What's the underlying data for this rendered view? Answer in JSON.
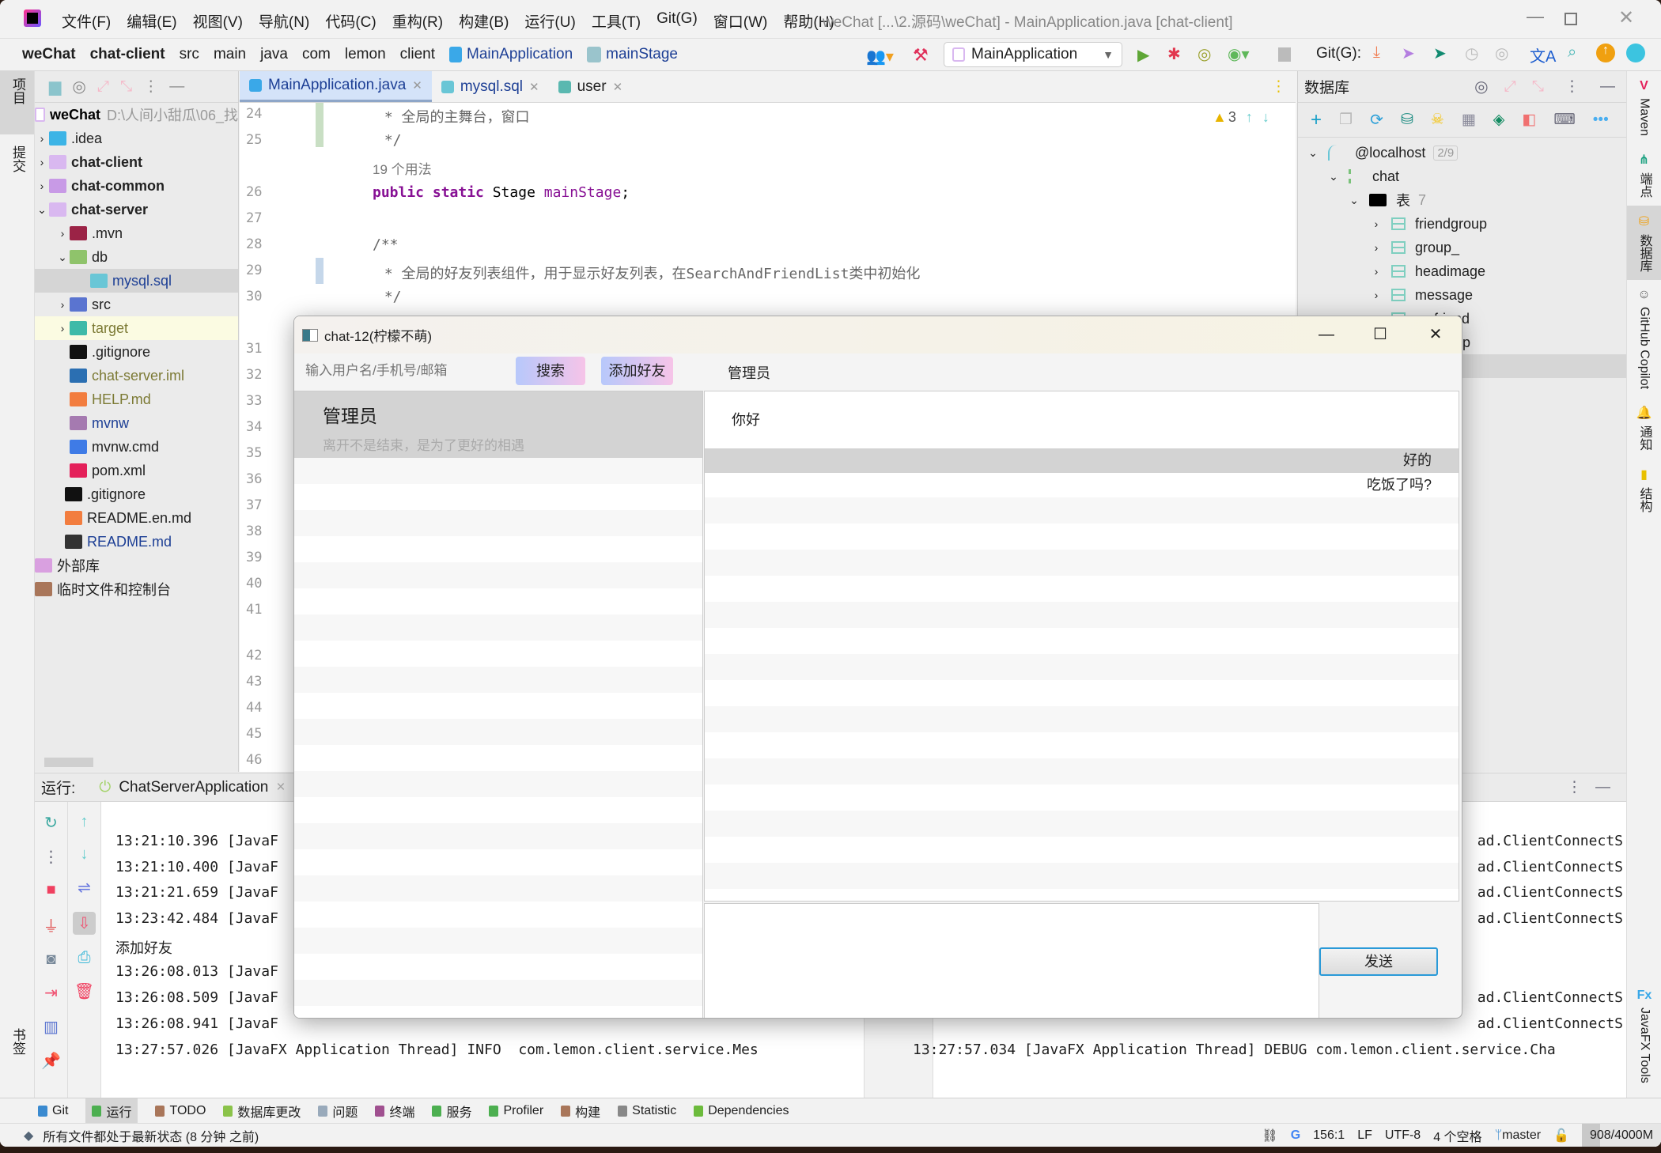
{
  "ide": {
    "title": "weChat [...\\2.源码\\weChat] - MainApplication.java [chat-client]",
    "menu": [
      "文件(F)",
      "编辑(E)",
      "视图(V)",
      "导航(N)",
      "代码(C)",
      "重构(R)",
      "构建(B)",
      "运行(U)",
      "工具(T)",
      "Git(G)",
      "窗口(W)",
      "帮助(H)"
    ],
    "breadcrumb": [
      "weChat",
      "chat-client",
      "src",
      "main",
      "java",
      "com",
      "lemon",
      "client",
      "MainApplication",
      "mainStage"
    ],
    "run_config": "MainApplication",
    "git_label": "Git(G):",
    "left_strip": [
      "项目",
      "提交",
      "书签"
    ],
    "right_strip": [
      "Maven",
      "端点",
      "数据库",
      "GitHub Copilot",
      "通知",
      "结构",
      "JavaFX Tools"
    ]
  },
  "project": {
    "root": "weChat",
    "root_path": "D:\\人间小甜瓜\\06_找",
    "items": [
      {
        "label": "weChat",
        "level": 0,
        "arrow": "",
        "color": "#000",
        "bold": true
      },
      {
        "label": ".idea",
        "level": 0,
        "arrow": "›",
        "color": "#222",
        "icon": "#3cb4e6"
      },
      {
        "label": "chat-client",
        "level": 0,
        "arrow": "›",
        "color": "#222",
        "bold": true,
        "icon": "#d9b8f0"
      },
      {
        "label": "chat-common",
        "level": 0,
        "arrow": "›",
        "color": "#222",
        "bold": true,
        "icon": "#c89ae6"
      },
      {
        "label": "chat-server",
        "level": 0,
        "arrow": "⌄",
        "color": "#222",
        "bold": true,
        "icon": "#d9b8f0"
      },
      {
        "label": ".mvn",
        "level": 1,
        "arrow": "›",
        "color": "#222",
        "icon": "#9b2346"
      },
      {
        "label": "db",
        "level": 1,
        "arrow": "⌄",
        "color": "#222",
        "icon": "#8fc36b"
      },
      {
        "label": "mysql.sql",
        "level": 2,
        "arrow": "",
        "color": "#1d3f95",
        "icon": "#69c6d6",
        "selected": true
      },
      {
        "label": "src",
        "level": 1,
        "arrow": "›",
        "color": "#222",
        "icon": "#5a74d0"
      },
      {
        "label": "target",
        "level": 1,
        "arrow": "›",
        "color": "#7c7a35",
        "icon": "#3ebaa8",
        "highlight": true
      },
      {
        "label": ".gitignore",
        "level": 1,
        "arrow": "",
        "color": "#222",
        "icon": "#111"
      },
      {
        "label": "chat-server.iml",
        "level": 1,
        "arrow": "",
        "color": "#7c7a35",
        "icon": "#2b6fb2"
      },
      {
        "label": "HELP.md",
        "level": 1,
        "arrow": "",
        "color": "#7c7a35",
        "icon": "#f27d3f"
      },
      {
        "label": "mvnw",
        "level": 1,
        "arrow": "",
        "color": "#1d3f95",
        "icon": "#a57ab0"
      },
      {
        "label": "mvnw.cmd",
        "level": 1,
        "arrow": "",
        "color": "#222",
        "icon": "#3f7be6"
      },
      {
        "label": "pom.xml",
        "level": 1,
        "arrow": "",
        "color": "#222",
        "icon": "#e4205a"
      },
      {
        "label": ".gitignore",
        "level": 0,
        "arrow": "",
        "color": "#222",
        "icon": "#111"
      },
      {
        "label": "README.en.md",
        "level": 0,
        "arrow": "",
        "color": "#222",
        "icon": "#f27d3f"
      },
      {
        "label": "README.md",
        "level": 0,
        "arrow": "",
        "color": "#1d3f95",
        "icon": "#333"
      },
      {
        "label": "外部库",
        "level": -1,
        "arrow": "",
        "color": "#222",
        "icon": "#d9a0e0"
      },
      {
        "label": "临时文件和控制台",
        "level": -1,
        "arrow": "",
        "color": "#222",
        "icon": "#a9765a"
      }
    ]
  },
  "editor": {
    "tabs": [
      {
        "label": "MainApplication.java",
        "active": true
      },
      {
        "label": "mysql.sql"
      },
      {
        "label": "user"
      }
    ],
    "warnings": "3",
    "gutter": [
      "24",
      "25",
      null,
      "26",
      "27",
      "28",
      "29",
      "30",
      null,
      "31",
      "32",
      "33",
      "34",
      "35",
      "36",
      "37",
      "38",
      "39",
      "40",
      "41",
      null,
      "42",
      "43",
      "44",
      "45",
      "46"
    ],
    "lines": [
      {
        "t": " * 全局的主舞台，窗口",
        "c": "cm"
      },
      {
        "t": " */",
        "c": "cm"
      },
      {
        "t": "19 个用法",
        "c": "inlay"
      },
      {
        "t": "public static Stage mainStage;",
        "c": "decl"
      },
      {
        "t": "",
        "c": ""
      },
      {
        "t": "/**",
        "c": "cm"
      },
      {
        "t": " * 全局的好友列表组件，用于显示好友列表，在SearchAndFriendList类中初始化",
        "c": "cm"
      },
      {
        "t": " */",
        "c": "cm"
      }
    ],
    "decl_parts": [
      "public static ",
      "Stage ",
      "mainStage",
      ";"
    ]
  },
  "database": {
    "title": "数据库",
    "host": "@localhost",
    "host_badge": "2/9",
    "schema": "chat",
    "tables_label": "表",
    "tables_count": "7",
    "tables": [
      "friendgroup",
      "group_",
      "headimage",
      "message",
      "myfriend",
      "mygroup"
    ]
  },
  "run": {
    "label": "运行:",
    "tab": "ChatServerApplication",
    "left_lines": [
      "13:21:10.396 [JavaF",
      "13:21:10.400 [JavaF",
      "13:21:21.659 [JavaF",
      "13:23:42.484 [JavaF",
      "添加好友",
      "13:26:08.013 [JavaF",
      "13:26:08.509 [JavaF",
      "13:26:08.941 [JavaF",
      "13:27:57.026 [JavaFX Application Thread] INFO  com.lemon.client.service.Mes"
    ],
    "right_lines": [
      "ad.ClientConnectS",
      "ad.ClientConnectS",
      "ad.ClientConnectS",
      "ad.ClientConnectS",
      "",
      "",
      "ad.ClientConnectS",
      "ad.ClientConnectS",
      "13:27:57.034 [JavaFX Application Thread] DEBUG com.lemon.client.service.Cha"
    ]
  },
  "bottom_tools": [
    "Git",
    "运行",
    "TODO",
    "数据库更改",
    "问题",
    "终端",
    "服务",
    "Profiler",
    "构建",
    "Statistic",
    "Dependencies"
  ],
  "status": {
    "message": "所有文件都处于最新状态 (8 分钟 之前)",
    "position": "156:1",
    "line_sep": "LF",
    "encoding": "UTF-8",
    "indent": "4 个空格",
    "branch": "master",
    "memory": "908/4000M",
    "memory_fraction": 0.227
  },
  "chat": {
    "title": "chat-12(柠檬不萌)",
    "search_placeholder": "输入用户名/手机号/邮箱",
    "search_btn": "搜索",
    "add_friend_btn": "添加好友",
    "current_contact": "管理员",
    "contacts": [
      {
        "name": "管理员",
        "signature": "离开不是结束，是为了更好的相遇"
      }
    ],
    "messages": [
      {
        "text": "你好",
        "side": "left"
      },
      {
        "text": "好的",
        "side": "right",
        "highlight": true
      },
      {
        "text": "吃饭了吗?",
        "side": "right"
      }
    ],
    "send_btn": "发送"
  }
}
